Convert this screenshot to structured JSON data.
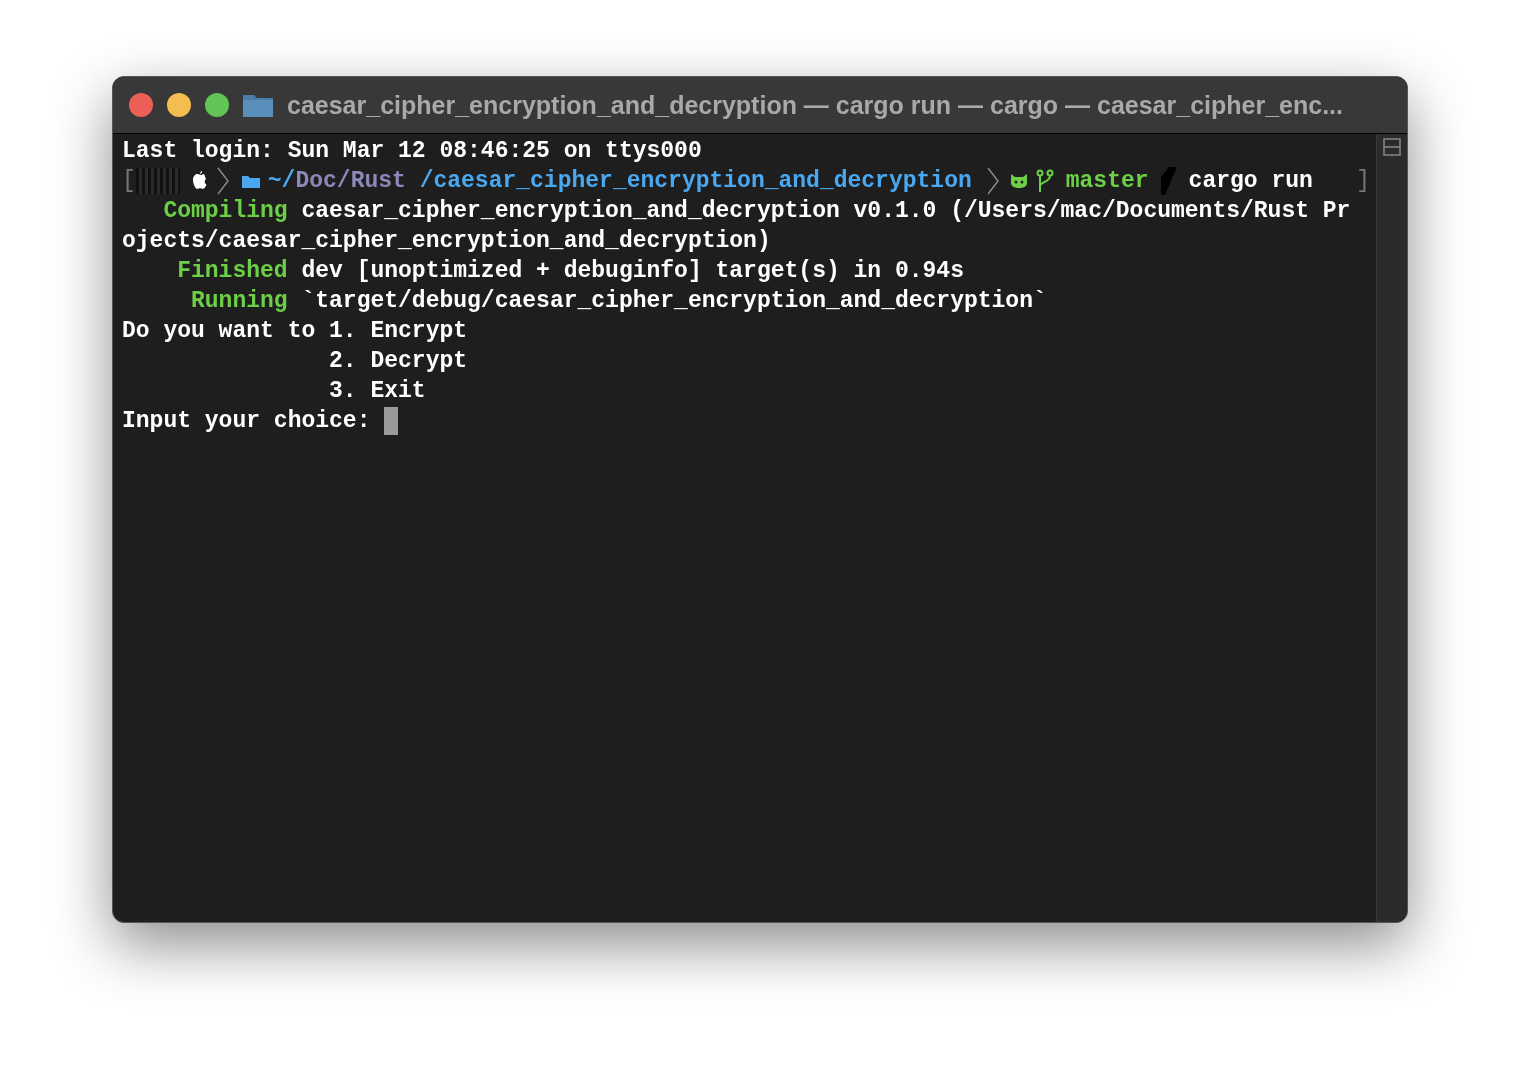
{
  "window": {
    "title": "caesar_cipher_encryption_and_decryption — cargo run — cargo — caesar_cipher_enc..."
  },
  "terminal": {
    "lines": [
      {
        "kind": "plain",
        "segments": [
          {
            "kind": "plain",
            "text": "Last login: Sun Mar 12 08:46:25 on ttys000"
          }
        ]
      },
      {
        "kind": "prompt",
        "open": "[",
        "home": "~/",
        "dir": "Doc/Rust",
        "repo": " /caesar_cipher_encryption_and_decryption",
        "branch": "master",
        "command": "cargo run",
        "close": "]"
      },
      {
        "kind": "plain",
        "segments": [
          {
            "kind": "status",
            "text": "   Compiling"
          },
          {
            "kind": "plain",
            "text": " caesar_cipher_encryption_and_decryption v0.1.0 (/Users/mac/Documents/Rust Pr"
          }
        ]
      },
      {
        "kind": "plain",
        "segments": [
          {
            "kind": "plain",
            "text": "ojects/caesar_cipher_encryption_and_decryption)"
          }
        ]
      },
      {
        "kind": "plain",
        "segments": [
          {
            "kind": "status",
            "text": "    Finished"
          },
          {
            "kind": "plain",
            "text": " dev [unoptimized + debuginfo] target(s) in 0.94s"
          }
        ]
      },
      {
        "kind": "plain",
        "segments": [
          {
            "kind": "status",
            "text": "     Running"
          },
          {
            "kind": "plain",
            "text": " `target/debug/caesar_cipher_encryption_and_decryption`"
          }
        ]
      },
      {
        "kind": "plain",
        "segments": [
          {
            "kind": "plain",
            "text": "Do you want to 1. Encrypt"
          }
        ]
      },
      {
        "kind": "plain",
        "segments": [
          {
            "kind": "plain",
            "text": "               2. Decrypt"
          }
        ]
      },
      {
        "kind": "plain",
        "segments": [
          {
            "kind": "plain",
            "text": "               3. Exit"
          }
        ]
      },
      {
        "kind": "input",
        "segments": [
          {
            "kind": "plain",
            "text": "Input your choice: "
          }
        ]
      }
    ]
  }
}
